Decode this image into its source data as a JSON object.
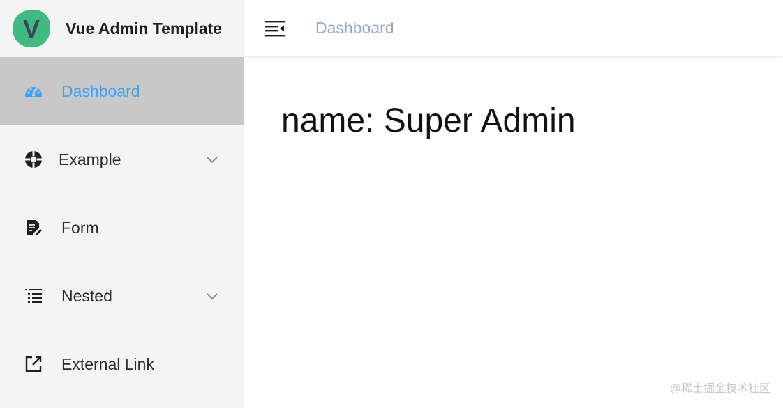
{
  "app": {
    "title": "Vue Admin Template",
    "logo_letter": "V",
    "colors": {
      "logo_green": "#42b883",
      "logo_dark": "#35495e",
      "active_blue": "#409eff",
      "breadcrumb_gray": "#97a8be",
      "sidebar_bg": "#f4f4f4",
      "sidebar_active_bg": "#c8c8c8"
    }
  },
  "sidebar": {
    "items": [
      {
        "label": "Dashboard",
        "icon": "dashboard-icon",
        "active": true,
        "has_children": false
      },
      {
        "label": "Example",
        "icon": "example-icon",
        "active": false,
        "has_children": true
      },
      {
        "label": "Form",
        "icon": "form-icon",
        "active": false,
        "has_children": false
      },
      {
        "label": "Nested",
        "icon": "nested-icon",
        "active": false,
        "has_children": true
      },
      {
        "label": "External Link",
        "icon": "external-link-icon",
        "active": false,
        "has_children": false
      }
    ]
  },
  "navbar": {
    "toggle_icon": "hamburger-icon",
    "breadcrumb": "Dashboard"
  },
  "dashboard": {
    "text": "name: Super Admin"
  },
  "watermark": "@稀土掘金技术社区"
}
